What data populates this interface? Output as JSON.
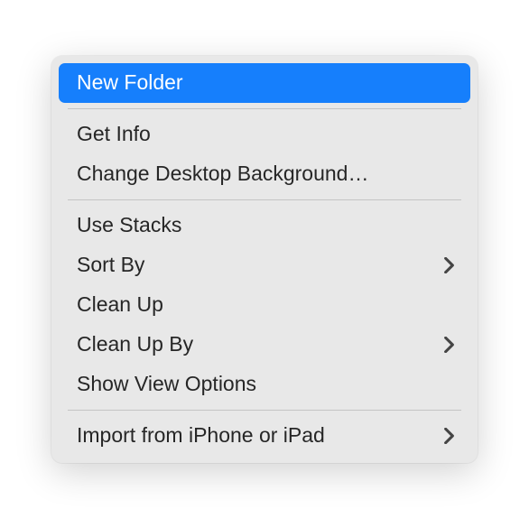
{
  "menu": {
    "groups": [
      [
        {
          "id": "new-folder",
          "label": "New Folder",
          "submenu": false,
          "highlighted": true
        }
      ],
      [
        {
          "id": "get-info",
          "label": "Get Info",
          "submenu": false,
          "highlighted": false
        },
        {
          "id": "change-desktop-background",
          "label": "Change Desktop Background…",
          "submenu": false,
          "highlighted": false
        }
      ],
      [
        {
          "id": "use-stacks",
          "label": "Use Stacks",
          "submenu": false,
          "highlighted": false
        },
        {
          "id": "sort-by",
          "label": "Sort By",
          "submenu": true,
          "highlighted": false
        },
        {
          "id": "clean-up",
          "label": "Clean Up",
          "submenu": false,
          "highlighted": false
        },
        {
          "id": "clean-up-by",
          "label": "Clean Up By",
          "submenu": true,
          "highlighted": false
        },
        {
          "id": "show-view-options",
          "label": "Show View Options",
          "submenu": false,
          "highlighted": false
        }
      ],
      [
        {
          "id": "import-from-iphone-or-ipad",
          "label": "Import from iPhone or iPad",
          "submenu": true,
          "highlighted": false
        }
      ]
    ]
  }
}
